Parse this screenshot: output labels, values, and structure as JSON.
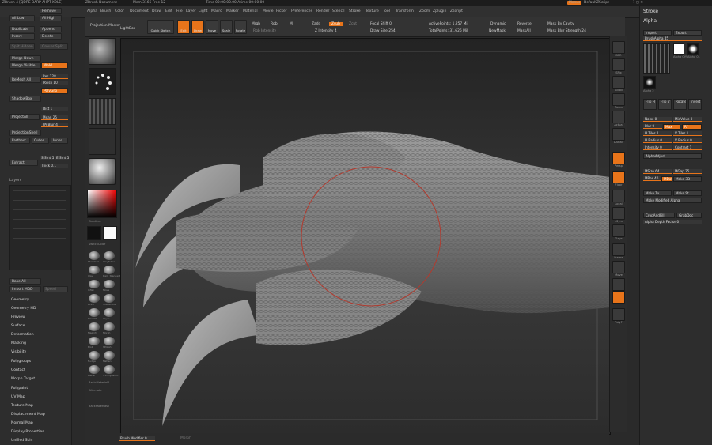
{
  "titlebar": {
    "app": "ZBrush 4 [QDRE-BARP-AHPT-XOLE]",
    "document": "ZBrush Document",
    "stats": "Mem 3166  Free 12",
    "timer": "Time 00:00:00.00  Atime 00:00:00",
    "menus_label": "Menus",
    "script_label": "DefaultZScript"
  },
  "menubar": {
    "items": [
      "Alpha",
      "Brush",
      "Color",
      "Document",
      "Draw",
      "Edit",
      "File",
      "Layer",
      "Light",
      "Macro",
      "Marker",
      "Material",
      "Movie",
      "Picker",
      "Preferences",
      "Render",
      "Stencil",
      "Stroke",
      "Texture",
      "Tool",
      "Transform",
      "Zoom",
      "Zplugin",
      "Zscript"
    ]
  },
  "left": {
    "buttons": {
      "remove": "Remove",
      "all_low": "All Low",
      "all_high": "All High",
      "duplicate": "Duplicate",
      "append": "Append",
      "insert": "Insert",
      "delete": "Delete",
      "split_hidden": "Split Hidden",
      "groups_split": "Groups Split",
      "merge_down": "Merge Down",
      "merge_visible": "Merge Visible",
      "weld": "Weld",
      "remesh_all": "ReMesh All",
      "res": "Res 128",
      "polish": "Polish 10",
      "polygrp": "PolyGrp",
      "shadowbox": "ShadowBox",
      "dist": "Dist 1",
      "mean": "Mean 25",
      "pa_blur": "PA Blur 4",
      "project_all": "ProjectAll",
      "projection_shell": "ProjectionShell",
      "farthest": "Farthest",
      "outer": "Outer",
      "inner": "Inner",
      "extract": "Extract",
      "s_smt": "S Smt 5",
      "e_smt": "E Smt 5",
      "thick": "Thick 0.1",
      "layers_label": "Layers",
      "bake_all": "Bake All",
      "import_mdd": "Import MDD",
      "speed": "Speed"
    },
    "menu_items": [
      "Geometry",
      "Geometry HD",
      "Preview",
      "Surface",
      "Deformation",
      "Masking",
      "Visibility",
      "Polygroups",
      "Contact",
      "Morph Target",
      "Polypaint",
      "UV Map",
      "Texture Map",
      "Displacement Map",
      "Normal Map",
      "Display Properties",
      "Unified Skin"
    ]
  },
  "brushcol": {
    "thumbs": [
      "Standard",
      "ClayTubes",
      "Clay",
      "Dam_Standard",
      "Inflat",
      "Move",
      "Pinch",
      "SnakeHook",
      "Smooth",
      "Layer",
      "Magnify",
      "Morph",
      "Blob",
      "hPolish",
      "Nudge",
      "Flatten",
      "Planar",
      "TrimDynamic"
    ],
    "gradient_label": "Gradient",
    "switch_color_label": "SwitchColor",
    "alternate_label": "Alternate",
    "material_label": "BasicMaterial",
    "material2_label": "BasicMaterial2",
    "backface_label": "BackFaceMask"
  },
  "toptool": {
    "projection_master": "Projection Master",
    "lightbox": "LightBox",
    "quick_sketch": "Quick Sketch",
    "edit": "Edit",
    "draw": "Draw",
    "move": "Move",
    "scale": "Scale",
    "rotate": "Rotate",
    "mrgb": "Mrgb",
    "rgb": "Rgb",
    "m": "M",
    "zadd": "Zadd",
    "zsub": "Zsub",
    "zcut": "Zcut",
    "focal_shift": "Focal Shift 0",
    "draw_size": "Draw Size 254",
    "z_intensity": "Z Intensity 4",
    "rgb_intensity": "Rgb Intensity",
    "active_points": "ActivePoints: 1,257 Mil",
    "total_points": "TotalPoints: 31.626 Mil",
    "dynamic": "Dynamic",
    "newmask": "NewMask",
    "clear": "Clear",
    "reverse": "Reverse",
    "maskall": "MaskAll",
    "mask_by_cavity": "Mask By Cavity",
    "mask_blur_strength": "Mask Blur Strength 24"
  },
  "rightshelf": {
    "buttons": [
      "BPR",
      "SPix",
      "Scroll",
      "Zoom",
      "Actual",
      "AAHalf",
      "Persp",
      "Floor",
      "Local",
      "LSym",
      "Gxyz",
      "Frame",
      "Move",
      "Scale",
      "Rotate",
      "PolyF",
      "Transp",
      "Ghost",
      "Solo",
      "Xpose"
    ]
  },
  "rightpanel": {
    "stroke_label": "Stroke",
    "alpha_label": "Alpha",
    "import": "Import",
    "export": "Export",
    "brush_alpha": "BrushAlpha 45",
    "alpha_off": "Alpha Off",
    "alpha_01": "Alpha 01",
    "alpha_2": "Alpha 2",
    "flip_h": "Flip H",
    "flip_v": "Flip V",
    "rotate": "Rotate",
    "invert": "Invert",
    "noise": "Noise 0",
    "midvalue": "MidValue 0",
    "blur": "Blur 0",
    "max": "Max",
    "rf": "Rf",
    "tiles_h": "H Tiles 1",
    "tiles_v": "V Tiles 1",
    "hrad": "H Radius 0",
    "vrad": "V Radius 0",
    "intensity": "Intensity 0",
    "contrast": "Contrast 1",
    "alpha_adjust": "AlphaAdjust",
    "msize": "MSize 64",
    "mgap": "MGap 25",
    "mres": "MRes 40",
    "mdot": "MDots",
    "mmode": "Make 3D",
    "make_st": "Make St",
    "make_tx": "Make Tx",
    "make_modified": "Make Modified Alpha",
    "crop_and_fill": "CropAndFill",
    "grab_doc": "GrabDoc",
    "depth_factor": "Alpha Depth Factor 0"
  },
  "bottombar": {
    "brush_modifier": "Brush Modifier 0",
    "morph": "Morph"
  }
}
